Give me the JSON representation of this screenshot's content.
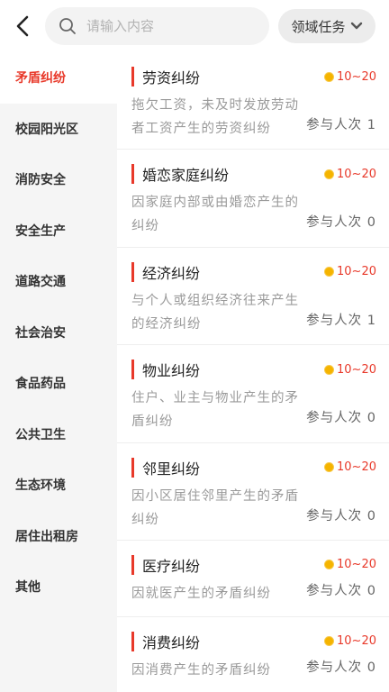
{
  "header": {
    "back_icon": "chevron-left-icon",
    "search": {
      "placeholder": "请输入内容",
      "value": "",
      "icon": "search-icon"
    },
    "domain_button": {
      "label": "领域任务",
      "icon": "chevron-down-icon"
    }
  },
  "sidebar": {
    "items": [
      {
        "label": "矛盾纠纷",
        "active": true
      },
      {
        "label": "校园阳光区",
        "active": false
      },
      {
        "label": "消防安全",
        "active": false
      },
      {
        "label": "安全生产",
        "active": false
      },
      {
        "label": "道路交通",
        "active": false
      },
      {
        "label": "社会治安",
        "active": false
      },
      {
        "label": "食品药品",
        "active": false
      },
      {
        "label": "公共卫生",
        "active": false
      },
      {
        "label": "生态环境",
        "active": false
      },
      {
        "label": "居住出租房",
        "active": false
      },
      {
        "label": "其他",
        "active": false
      }
    ]
  },
  "tasks": [
    {
      "title": "劳资纠纷",
      "reward": "10~20",
      "description": "拖欠工资，未及时发放劳动者工资产生的劳资纠纷",
      "participants_label": "参与人次",
      "participants": "1"
    },
    {
      "title": "婚恋家庭纠纷",
      "reward": "10~20",
      "description": "因家庭内部或由婚恋产生的纠纷",
      "participants_label": "参与人次",
      "participants": "0"
    },
    {
      "title": "经济纠纷",
      "reward": "10~20",
      "description": "与个人或组织经济往来产生的经济纠纷",
      "participants_label": "参与人次",
      "participants": "1"
    },
    {
      "title": "物业纠纷",
      "reward": "10~20",
      "description": "住户、业主与物业产生的矛盾纠纷",
      "participants_label": "参与人次",
      "participants": "0"
    },
    {
      "title": "邻里纠纷",
      "reward": "10~20",
      "description": "因小区居住邻里产生的矛盾纠纷",
      "participants_label": "参与人次",
      "participants": "0"
    },
    {
      "title": "医疗纠纷",
      "reward": "10~20",
      "description": "因就医产生的矛盾纠纷",
      "participants_label": "参与人次",
      "participants": "0"
    },
    {
      "title": "消费纠纷",
      "reward": "10~20",
      "description": "因消费产生的矛盾纠纷",
      "participants_label": "参与人次",
      "participants": "0"
    }
  ],
  "colors": {
    "accent": "#e8392a",
    "coin": "#f5b400",
    "sidebar_bg": "#f5f5f5"
  }
}
